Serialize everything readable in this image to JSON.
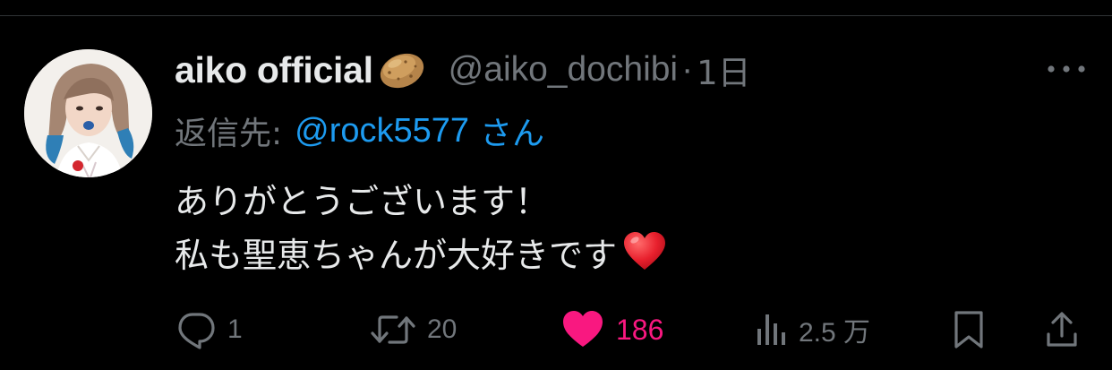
{
  "tweet": {
    "display_name": "aiko official",
    "name_emoji_icon": "potato-emoji",
    "handle": "@aiko_dochibi",
    "separator": "·",
    "time": "1日",
    "reply": {
      "label": "返信先:",
      "mention": "@rock5577",
      "suffix": "さん"
    },
    "text_lines": [
      "ありがとうございます！",
      "私も聖恵ちゃんが大好きです"
    ],
    "text_emoji_icon": "red-heart-emoji"
  },
  "actions": {
    "reply": {
      "icon": "reply-icon",
      "count": "1"
    },
    "retweet": {
      "icon": "retweet-icon",
      "count": "20"
    },
    "like": {
      "icon": "heart-filled-icon",
      "count": "186",
      "liked": true
    },
    "views": {
      "icon": "views-icon",
      "count": "2.5 万"
    },
    "bookmark": {
      "icon": "bookmark-icon"
    },
    "share": {
      "icon": "share-icon"
    }
  },
  "colors": {
    "background": "#000000",
    "text": "#e7e9ea",
    "muted": "#71767b",
    "link": "#1d9bf0",
    "like": "#f91880",
    "divider": "#2f3336"
  }
}
